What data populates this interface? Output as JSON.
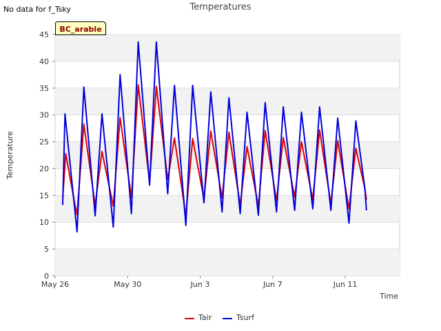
{
  "header": {
    "no_data_note": "No data for f_Tsky"
  },
  "chart_data": {
    "type": "line",
    "title": "Temperatures",
    "xlabel": "Time",
    "ylabel": "Temperature",
    "badge": "BC_arable",
    "ylim": [
      0,
      45
    ],
    "yticks": [
      0,
      5,
      10,
      15,
      20,
      25,
      30,
      35,
      40,
      45
    ],
    "xlim": [
      "2023-05-26",
      "2023-06-14"
    ],
    "xticks": [
      {
        "date": "2023-05-26",
        "label": "May 26"
      },
      {
        "date": "2023-05-30",
        "label": "May 30"
      },
      {
        "date": "2023-06-03",
        "label": "Jun 3"
      },
      {
        "date": "2023-06-07",
        "label": "Jun 7"
      },
      {
        "date": "2023-06-11",
        "label": "Jun 11"
      }
    ],
    "grid": true,
    "legend_position": "bottom-center",
    "series": [
      {
        "name": "Tair",
        "color": "#dd0000",
        "points": [
          [
            "2023-05-26T10:00",
            14.4
          ],
          [
            "2023-05-26T14:00",
            22.8
          ],
          [
            "2023-05-27T02:00",
            13.4
          ],
          [
            "2023-05-27T05:00",
            11.4
          ],
          [
            "2023-05-27T14:00",
            28.3
          ],
          [
            "2023-05-28T05:00",
            13.1
          ],
          [
            "2023-05-28T14:00",
            23.2
          ],
          [
            "2023-05-29T05:00",
            13.0
          ],
          [
            "2023-05-29T14:00",
            29.5
          ],
          [
            "2023-05-30T05:00",
            14.5
          ],
          [
            "2023-05-30T14:00",
            35.6
          ],
          [
            "2023-05-31T05:00",
            17.4
          ],
          [
            "2023-05-31T14:00",
            35.3
          ],
          [
            "2023-06-01T05:00",
            18.0
          ],
          [
            "2023-06-01T14:00",
            25.7
          ],
          [
            "2023-06-02T05:00",
            11.2
          ],
          [
            "2023-06-02T14:00",
            25.6
          ],
          [
            "2023-06-03T05:00",
            14.3
          ],
          [
            "2023-06-03T14:00",
            27.0
          ],
          [
            "2023-06-04T05:00",
            14.5
          ],
          [
            "2023-06-04T14:00",
            26.8
          ],
          [
            "2023-06-05T05:00",
            13.2
          ],
          [
            "2023-06-05T14:00",
            24.1
          ],
          [
            "2023-06-06T05:00",
            13.0
          ],
          [
            "2023-06-06T14:00",
            27.1
          ],
          [
            "2023-06-07T05:00",
            14.0
          ],
          [
            "2023-06-07T14:00",
            25.8
          ],
          [
            "2023-06-08T05:00",
            14.7
          ],
          [
            "2023-06-08T14:00",
            25.0
          ],
          [
            "2023-06-09T05:00",
            14.2
          ],
          [
            "2023-06-09T14:00",
            27.2
          ],
          [
            "2023-06-10T05:00",
            13.4
          ],
          [
            "2023-06-10T14:00",
            25.2
          ],
          [
            "2023-06-11T05:00",
            12.5
          ],
          [
            "2023-06-11T14:00",
            23.8
          ],
          [
            "2023-06-12T02:00",
            16.2
          ],
          [
            "2023-06-12T04:00",
            14.2
          ]
        ]
      },
      {
        "name": "Tsurf",
        "color": "#0000dd",
        "points": [
          [
            "2023-05-26T10:00",
            13.2
          ],
          [
            "2023-05-26T13:00",
            30.2
          ],
          [
            "2023-05-27T05:00",
            8.2
          ],
          [
            "2023-05-27T14:00",
            35.2
          ],
          [
            "2023-05-28T05:00",
            11.2
          ],
          [
            "2023-05-28T14:00",
            30.2
          ],
          [
            "2023-05-29T05:00",
            9.1
          ],
          [
            "2023-05-29T14:00",
            37.5
          ],
          [
            "2023-05-30T05:00",
            11.6
          ],
          [
            "2023-05-30T14:00",
            43.6
          ],
          [
            "2023-05-31T05:00",
            16.9
          ],
          [
            "2023-05-31T14:00",
            43.6
          ],
          [
            "2023-06-01T05:00",
            15.3
          ],
          [
            "2023-06-01T14:00",
            35.5
          ],
          [
            "2023-06-02T05:00",
            9.4
          ],
          [
            "2023-06-02T14:00",
            35.5
          ],
          [
            "2023-06-03T05:00",
            13.6
          ],
          [
            "2023-06-03T14:00",
            34.3
          ],
          [
            "2023-06-04T05:00",
            11.9
          ],
          [
            "2023-06-04T14:00",
            33.2
          ],
          [
            "2023-06-05T05:00",
            11.6
          ],
          [
            "2023-06-05T14:00",
            30.5
          ],
          [
            "2023-06-06T05:00",
            11.3
          ],
          [
            "2023-06-06T14:00",
            32.3
          ],
          [
            "2023-06-07T05:00",
            11.9
          ],
          [
            "2023-06-07T14:00",
            31.5
          ],
          [
            "2023-06-08T05:00",
            12.2
          ],
          [
            "2023-06-08T14:00",
            30.5
          ],
          [
            "2023-06-09T05:00",
            12.5
          ],
          [
            "2023-06-09T14:00",
            31.5
          ],
          [
            "2023-06-10T05:00",
            12.2
          ],
          [
            "2023-06-10T14:00",
            29.4
          ],
          [
            "2023-06-11T05:00",
            9.8
          ],
          [
            "2023-06-11T14:00",
            28.9
          ],
          [
            "2023-06-12T02:00",
            16.2
          ],
          [
            "2023-06-12T04:00",
            12.2
          ]
        ]
      }
    ]
  }
}
